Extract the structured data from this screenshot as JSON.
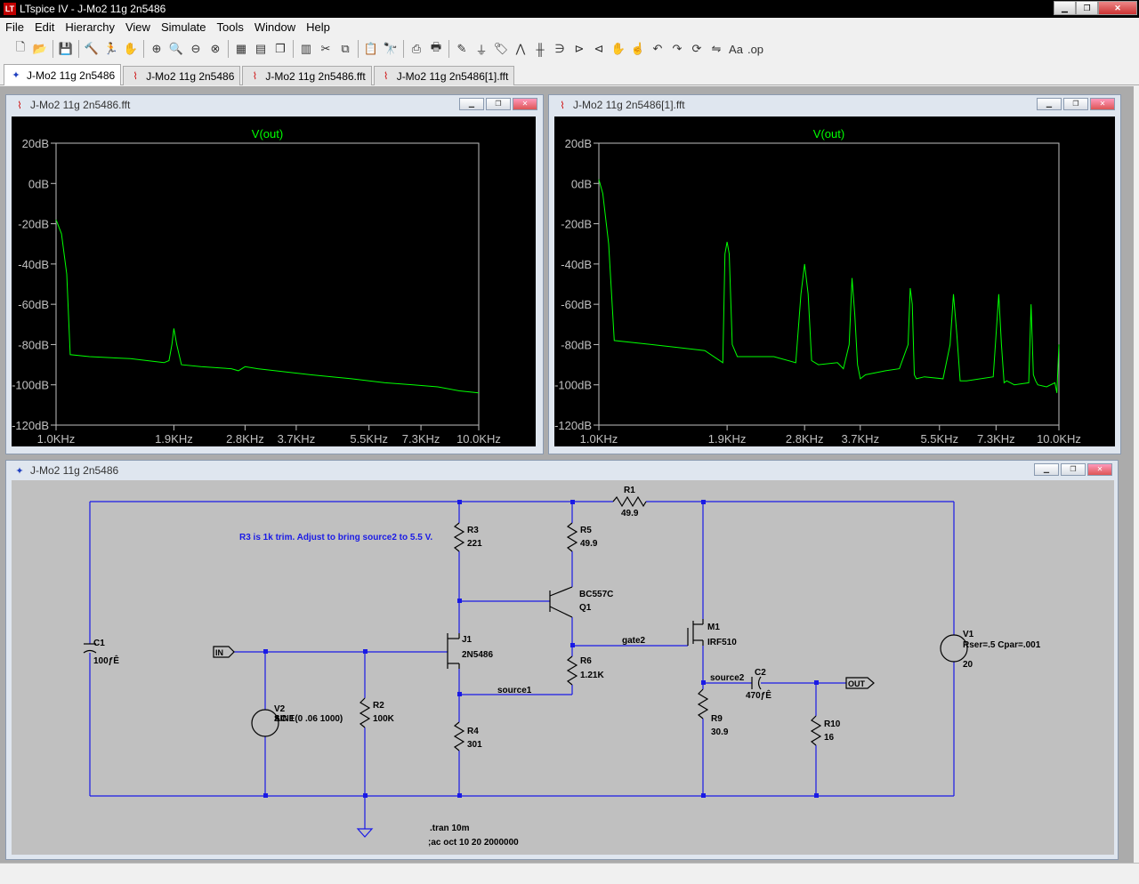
{
  "window": {
    "title": "LTspice IV - J-Mo2 11g 2n5486",
    "logo": "LT"
  },
  "menu": [
    "File",
    "Edit",
    "Hierarchy",
    "View",
    "Simulate",
    "Tools",
    "Window",
    "Help"
  ],
  "toolbar_icons": [
    "new-schematic-icon",
    "open-icon",
    "save-icon",
    "control-panel-icon",
    "run-icon",
    "halt-icon",
    "zoom-in-icon",
    "zoom-pan-icon",
    "zoom-out-icon",
    "zoom-fit-icon",
    "autorange-icon",
    "tile-horizontal-icon",
    "cascade-icon",
    "tile-vertical-icon",
    "cut-icon",
    "copy-icon",
    "paste-icon",
    "find-icon",
    "print-setup-icon",
    "print-icon",
    "wire-icon",
    "ground-icon",
    "label-icon",
    "resistor-icon",
    "capacitor-icon",
    "inductor-icon",
    "diode-icon",
    "component-icon",
    "move-icon",
    "drag-icon",
    "undo-icon",
    "redo-icon",
    "rotate-icon",
    "mirror-icon",
    "text-icon",
    "spice-directive-icon"
  ],
  "tabs": [
    {
      "label": "J-Mo2 11g 2n5486",
      "icon": "schematic-icon",
      "active": true
    },
    {
      "label": "J-Mo2 11g 2n5486",
      "icon": "plot-icon",
      "active": false
    },
    {
      "label": "J-Mo2 11g 2n5486.fft",
      "icon": "plot-icon",
      "active": false
    },
    {
      "label": "J-Mo2 11g 2n5486[1].fft",
      "icon": "plot-icon",
      "active": false
    }
  ],
  "plot_left": {
    "title": "J-Mo2 11g 2n5486.fft",
    "trace": "V(out)",
    "y_ticks": [
      "20dB",
      "0dB",
      "-20dB",
      "-40dB",
      "-60dB",
      "-80dB",
      "-100dB",
      "-120dB"
    ],
    "x_ticks": [
      "1.0KHz",
      "1.9KHz",
      "2.8KHz",
      "3.7KHz",
      "5.5KHz",
      "7.3KHz",
      "10.0KHz"
    ]
  },
  "plot_right": {
    "title": "J-Mo2 11g 2n5486[1].fft",
    "trace": "V(out)",
    "y_ticks": [
      "20dB",
      "0dB",
      "-20dB",
      "-40dB",
      "-60dB",
      "-80dB",
      "-100dB",
      "-120dB"
    ],
    "x_ticks": [
      "1.0KHz",
      "1.9KHz",
      "2.8KHz",
      "3.7KHz",
      "5.5KHz",
      "7.3KHz",
      "10.0KHz"
    ]
  },
  "chart_data": [
    {
      "type": "line",
      "title": "V(out)",
      "xscale": "log",
      "xlim": [
        1000,
        10000
      ],
      "ylim": [
        -120,
        20
      ],
      "xlabel": "",
      "ylabel": "",
      "grid": false,
      "series": [
        {
          "name": "V(out)",
          "color": "#00ff00",
          "x": [
            1000,
            1030,
            1060,
            1080,
            1200,
            1500,
            1800,
            1850,
            1880,
            1900,
            1930,
            1980,
            2200,
            2600,
            2700,
            2800,
            3000,
            4000,
            5000,
            6000,
            7000,
            8000,
            9000,
            10000
          ],
          "y": [
            -18,
            -25,
            -45,
            -85,
            -86,
            -87,
            -89,
            -88,
            -80,
            -72,
            -80,
            -90,
            -91,
            -92,
            -93,
            -91,
            -92,
            -95,
            -97,
            -99,
            -100,
            -101,
            -103,
            -104
          ]
        }
      ]
    },
    {
      "type": "line",
      "title": "V(out)",
      "xscale": "log",
      "xlim": [
        1000,
        10000
      ],
      "ylim": [
        -120,
        20
      ],
      "xlabel": "",
      "ylabel": "",
      "grid": false,
      "series": [
        {
          "name": "V(out)",
          "color": "#00ff00",
          "x": [
            1000,
            1020,
            1050,
            1080,
            1300,
            1700,
            1860,
            1880,
            1900,
            1920,
            1950,
            2000,
            2400,
            2680,
            2750,
            2800,
            2850,
            2900,
            3000,
            3300,
            3400,
            3500,
            3550,
            3600,
            3650,
            3700,
            3800,
            4200,
            4500,
            4700,
            4750,
            4800,
            4850,
            4900,
            5100,
            5600,
            5800,
            5900,
            6000,
            6100,
            6300,
            7200,
            7400,
            7500,
            7600,
            7700,
            8000,
            8600,
            8700,
            8800,
            8900,
            9000,
            9400,
            9800,
            9900,
            10000
          ],
          "y": [
            2,
            -5,
            -30,
            -78,
            -80,
            -83,
            -89,
            -35,
            -29,
            -35,
            -80,
            -86,
            -86,
            -89,
            -55,
            -40,
            -55,
            -88,
            -90,
            -89,
            -92,
            -80,
            -47,
            -65,
            -90,
            -97,
            -95,
            -93,
            -92,
            -80,
            -52,
            -60,
            -95,
            -97,
            -96,
            -97,
            -80,
            -55,
            -75,
            -98,
            -98,
            -96,
            -55,
            -80,
            -99,
            -98,
            -100,
            -99,
            -60,
            -95,
            -98,
            -100,
            -101,
            -99,
            -104,
            -80
          ]
        }
      ]
    }
  ],
  "schematic": {
    "title": "J-Mo2 11g 2n5486",
    "comment": "R3 is 1k trim. Adjust to bring source2 to 5.5 V.",
    "components": {
      "R1": {
        "name": "R1",
        "value": "49.9"
      },
      "R2": {
        "name": "R2",
        "value": "100K"
      },
      "R3": {
        "name": "R3",
        "value": "221"
      },
      "R4": {
        "name": "R4",
        "value": "301"
      },
      "R5": {
        "name": "R5",
        "value": "49.9"
      },
      "R6": {
        "name": "R6",
        "value": "1.21K"
      },
      "R9": {
        "name": "R9",
        "value": "30.9"
      },
      "R10": {
        "name": "R10",
        "value": "16"
      },
      "C1": {
        "name": "C1",
        "value": "100ƒÊ"
      },
      "C2": {
        "name": "C2",
        "value": "470ƒÊ"
      },
      "J1": {
        "name": "J1",
        "value": "2N5486"
      },
      "Q1": {
        "name": "Q1",
        "value": "BC557C"
      },
      "M1": {
        "name": "M1",
        "value": "IRF510"
      },
      "V1": {
        "name": "V1",
        "value": "20",
        "extra": "Rser=.5 Cpar=.001"
      },
      "V2": {
        "name": "V2",
        "value1": "SINE(0 .06 1000)",
        "value2": "AC 1"
      }
    },
    "nets": {
      "gate2": "gate2",
      "source1": "source1",
      "source2": "source2"
    },
    "labels": {
      "in": "IN",
      "out": "OUT"
    },
    "directives": [
      ".tran 10m",
      ";ac oct 10 20 2000000"
    ]
  }
}
